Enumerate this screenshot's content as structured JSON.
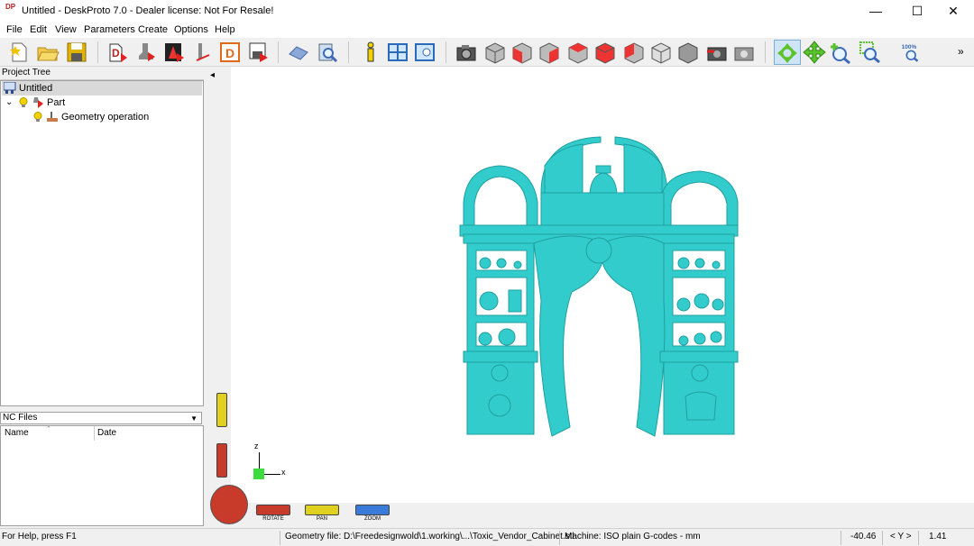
{
  "window": {
    "app_icon_text": "DP",
    "title": "Untitled - DeskProto 7.0 - Dealer license: Not For Resale!",
    "minimize": "—",
    "maximize": "☐",
    "close": "✕"
  },
  "menu": [
    "File",
    "Edit",
    "View",
    "Parameters",
    "Create",
    "Options",
    "Help"
  ],
  "toolbar": {
    "zoom_percent_label": "100%",
    "overflow": "»"
  },
  "project_tree": {
    "header": "Project Tree",
    "root": "Untitled",
    "part": "Part",
    "operation": "Geometry operation"
  },
  "nc_files": {
    "header": "NC Files",
    "col_name": "Name",
    "col_date": "Date"
  },
  "viewport": {
    "collapse_arrow": "◂",
    "axis_z": "z",
    "axis_x": "x",
    "rotate_label": "ROTATE",
    "pan_label": "PAN",
    "zoom_label": "ZOOM"
  },
  "status": {
    "help": "For Help, press F1",
    "geometry_file": "Geometry file: D:\\Freedesignwold\\1.working\\...\\Toxic_Vendor_Cabinet.stl",
    "machine": "Machine: ISO plain G-codes - mm",
    "coord_value": "-40.46",
    "axis_indicator": "< Y >",
    "scale_value": "1.41"
  },
  "colors": {
    "model": "#33cccc",
    "model_dark": "#1f9f9f",
    "rotate": "#c83a2a",
    "pan": "#e0d020",
    "zoom": "#3a7ad8"
  }
}
